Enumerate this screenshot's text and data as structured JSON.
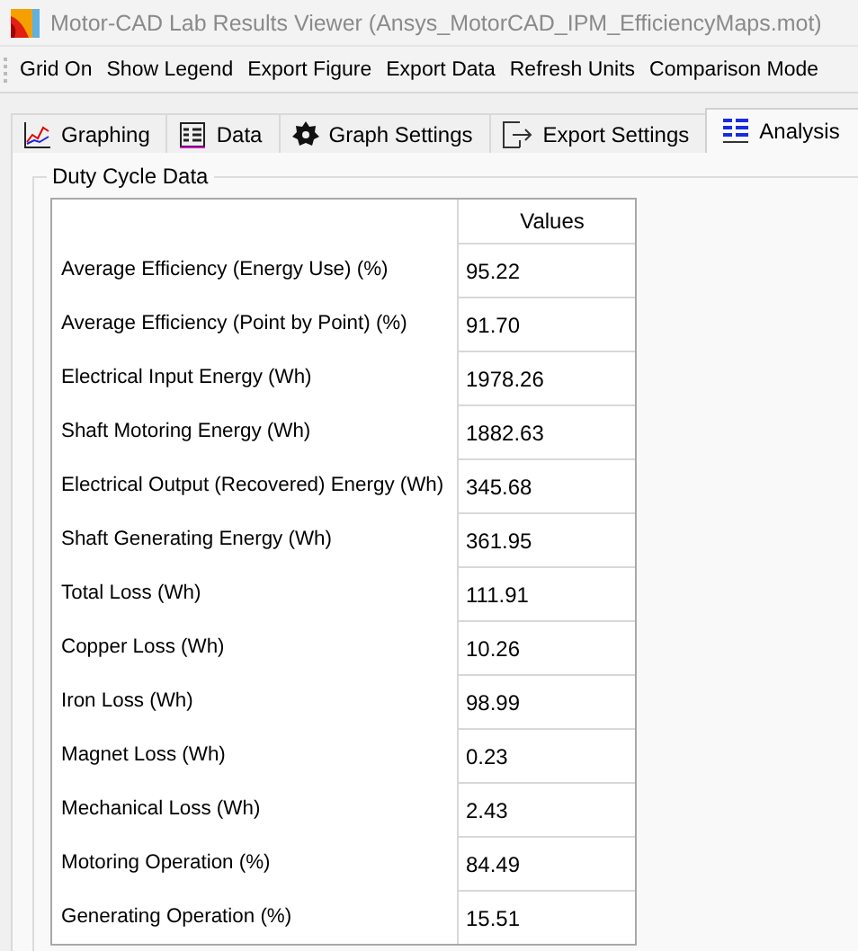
{
  "window": {
    "title": "Motor-CAD Lab Results Viewer (Ansys_MotorCAD_IPM_EfficiencyMaps.mot)"
  },
  "menu": [
    "Grid On",
    "Show Legend",
    "Export Figure",
    "Export Data",
    "Refresh Units",
    "Comparison Mode"
  ],
  "tabs": [
    {
      "label": "Graphing",
      "kind": "graph",
      "selected": false
    },
    {
      "label": "Data",
      "kind": "grid",
      "selected": false
    },
    {
      "label": "Graph Settings",
      "kind": "gear",
      "selected": false
    },
    {
      "label": "Export Settings",
      "kind": "export",
      "selected": false
    },
    {
      "label": "Analysis",
      "kind": "list",
      "selected": true
    }
  ],
  "group": {
    "title": "Duty Cycle Data",
    "table": {
      "columns": [
        "Values"
      ],
      "rows": [
        {
          "label": "Average Efficiency (Energy Use) (%)",
          "value": "95.22"
        },
        {
          "label": "Average Efficiency (Point by Point) (%)",
          "value": "91.70"
        },
        {
          "label": "Electrical Input Energy (Wh)",
          "value": "1978.26"
        },
        {
          "label": "Shaft Motoring Energy (Wh)",
          "value": "1882.63"
        },
        {
          "label": "Electrical Output (Recovered) Energy (Wh)",
          "value": "345.68"
        },
        {
          "label": "Shaft Generating Energy (Wh)",
          "value": "361.95"
        },
        {
          "label": "Total Loss (Wh)",
          "value": "111.91"
        },
        {
          "label": "Copper Loss (Wh)",
          "value": "10.26"
        },
        {
          "label": "Iron Loss (Wh)",
          "value": "98.99"
        },
        {
          "label": "Magnet Loss (Wh)",
          "value": "0.23"
        },
        {
          "label": "Mechanical Loss (Wh)",
          "value": "2.43"
        },
        {
          "label": "Motoring Operation (%)",
          "value": "84.49"
        },
        {
          "label": "Generating Operation (%)",
          "value": "15.51"
        }
      ]
    }
  }
}
